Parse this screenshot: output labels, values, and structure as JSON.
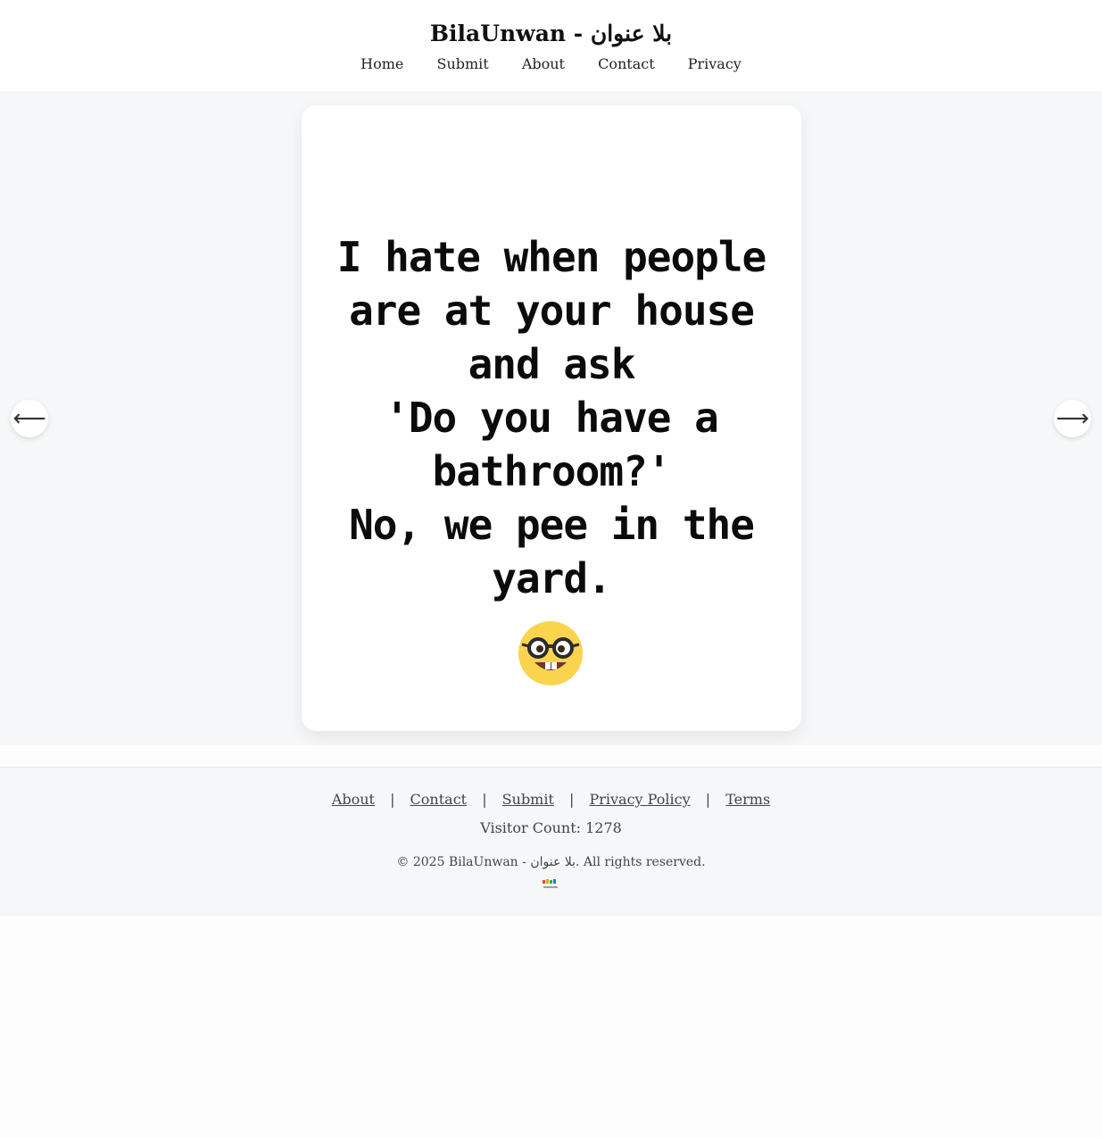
{
  "header": {
    "site_title": "BilaUnwan - بلا عنوان",
    "nav": [
      "Home",
      "Submit",
      "About",
      "Contact",
      "Privacy"
    ]
  },
  "card": {
    "quote": "I hate when people\nare at your house\nand ask\n'Do you have a\nbathroom?'\nNo, we pee in the\nyard.",
    "emoji": "nerd-face"
  },
  "controls": {
    "prev_arrow": "⟵",
    "next_arrow": "⟶"
  },
  "footer": {
    "links": [
      "About",
      "Contact",
      "Submit",
      "Privacy Policy",
      "Terms"
    ],
    "separator": "|",
    "visitor_count": "Visitor Count: 1278",
    "copyright": "© 2025 BilaUnwan - بلا عنوان. All rights reserved."
  },
  "colors": {
    "band_background": "#f6f7f9",
    "card_background": "#ffffff",
    "emoji_yellow": "#fcd34d"
  }
}
